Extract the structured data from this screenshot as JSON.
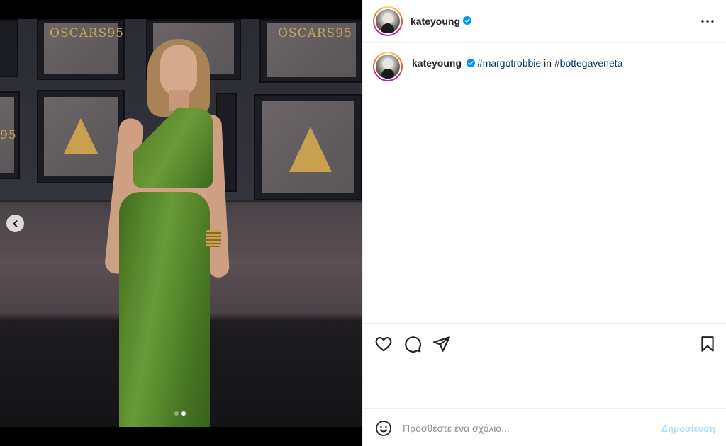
{
  "media": {
    "backdrop_text": [
      "OSCARS95",
      "OSCARS95",
      "95"
    ],
    "carousel": {
      "dots": 2,
      "active_index": 1
    }
  },
  "header": {
    "username": "kateyoung",
    "verified": true
  },
  "caption": {
    "username": "kateyoung",
    "verified": true,
    "parts": [
      {
        "type": "hashtag",
        "text": "#margotrobbie"
      },
      {
        "type": "text",
        "text": " in "
      },
      {
        "type": "hashtag",
        "text": "#bottegaveneta"
      }
    ]
  },
  "actions": {
    "icons": [
      "heart-icon",
      "comment-icon",
      "share-icon",
      "bookmark-icon"
    ]
  },
  "comment": {
    "placeholder": "Προσθέστε ένα σχόλιο...",
    "post_label": "Δημοσίευση"
  },
  "colors": {
    "verified_blue": "#0095f6",
    "link_blue": "#00376b",
    "post_disabled": "#b2dffc",
    "dress_green": "#5a8a2f"
  }
}
